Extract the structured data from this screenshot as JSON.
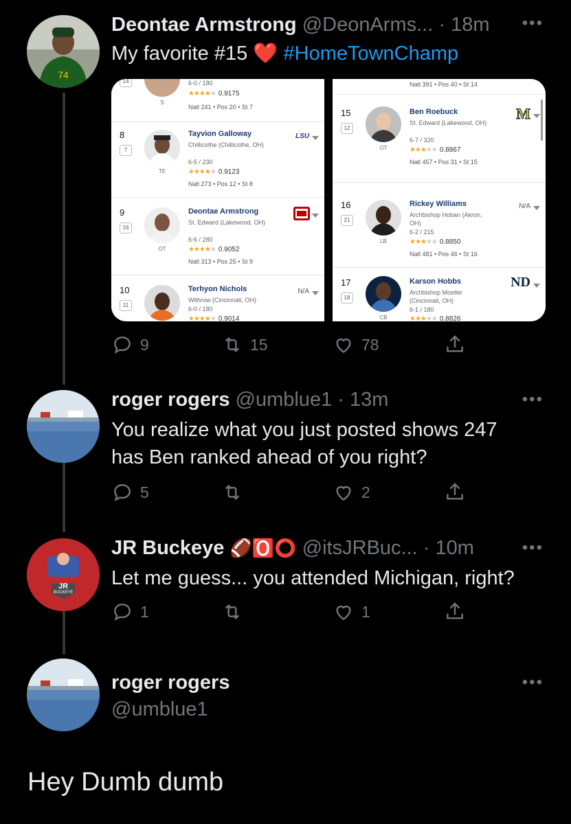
{
  "tweet1": {
    "name": "Deontae Armstrong",
    "handle": "@DeonArms...",
    "time": "· 18m",
    "text": "My favorite  #15",
    "heart": "❤️",
    "hashtag": "#HomeTownChamp",
    "replies": "9",
    "retweets": "15",
    "likes": "78"
  },
  "ranking": {
    "left": [
      {
        "rank": "",
        "prev": "14",
        "pos": "S",
        "name": "",
        "school": "",
        "measure": "6-0 / 180",
        "stars": 4,
        "score": "0.9175",
        "natl": "Natl 241 • Pos 20 • St 7",
        "team": ""
      },
      {
        "rank": "8",
        "prev": "7",
        "pos": "TE",
        "name": "Tayvion Galloway",
        "school": "Chillicothe (Chillicothe, OH)",
        "measure": "6-5 / 230",
        "stars": 4,
        "score": "0.9123",
        "natl": "Natl 273 • Pos 12 • St 8",
        "team": "LSU"
      },
      {
        "rank": "9",
        "prev": "16",
        "pos": "OT",
        "name": "Deontae Armstrong",
        "school": "St. Edward (Lakewood, OH)",
        "measure": "6-6 / 280",
        "stars": 4,
        "score": "0.9052",
        "natl": "Natl 313 • Pos 25 • St 9",
        "team": "OSU"
      },
      {
        "rank": "10",
        "prev": "11",
        "pos": "",
        "name": "Terhyon Nichols",
        "school": "Withrow (Cincinnati, OH)",
        "measure": "6-0 / 180",
        "stars": 4,
        "score": "0.9014",
        "natl": "",
        "team": "N/A"
      }
    ],
    "right": [
      {
        "rank": "",
        "prev": "",
        "pos": "",
        "name": "",
        "school": "",
        "measure": "",
        "stars": 0,
        "score": "",
        "natl": "Natl 391 • Pos 40 • St 14",
        "team": ""
      },
      {
        "rank": "15",
        "prev": "12",
        "pos": "OT",
        "name": "Ben Roebuck",
        "school": "St. Edward (Lakewood, OH)",
        "measure": "6-7 / 320",
        "stars": 3,
        "score": "0.8867",
        "natl": "Natl 457 • Pos 31 • St 15",
        "team": "M"
      },
      {
        "rank": "16",
        "prev": "21",
        "pos": "LB",
        "name": "Rickey Williams",
        "school": "Archbishop Hoban (Akron, OH)",
        "measure": "6-2 / 215",
        "stars": 3,
        "score": "0.8850",
        "natl": "Natl 481 • Pos 46 • St 16",
        "team": "N/A"
      },
      {
        "rank": "17",
        "prev": "18",
        "pos": "CB",
        "name": "Karson Hobbs",
        "school": "Archbishop Moeller (Cincinnati, OH)",
        "measure": "6-1 / 180",
        "stars": 3,
        "score": "0.8826",
        "natl": "",
        "team": "ND"
      }
    ]
  },
  "tweet2": {
    "name": "roger rogers",
    "handle": "@umblue1",
    "time": "· 13m",
    "text_line1": "You realize what you just posted shows 247",
    "text_line2": "has Ben ranked ahead of you right?",
    "replies": "5",
    "retweets": "",
    "likes": "2"
  },
  "tweet3": {
    "name": "JR Buckeye",
    "emoji": "🏈🅾️⭕",
    "handle": "@itsJRBuc...",
    "time": "· 10m",
    "text": "Let me guess... you attended Michigan, right?",
    "replies": "1",
    "retweets": "",
    "likes": "1",
    "avatar_label_1": "JR",
    "avatar_label_2": "BUCKEYE"
  },
  "tweet4": {
    "name": "roger rogers",
    "handle": "@umblue1",
    "text": "Hey Dumb dumb"
  },
  "more_icon": "•••",
  "colors": {
    "background": "#000000",
    "text": "#e7e9ea",
    "secondary": "#71767b",
    "link": "#1d9bf0",
    "thread_line": "#333639"
  }
}
